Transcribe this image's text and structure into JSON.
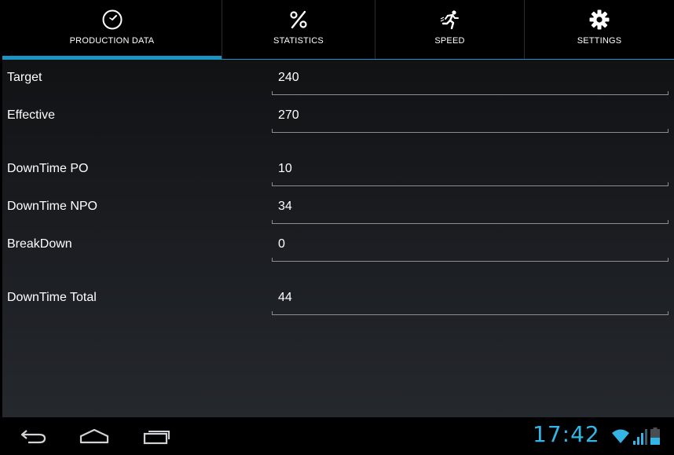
{
  "tabs": [
    {
      "label": "PRODUCTION DATA",
      "icon": "clock-gauge-icon",
      "selected": true
    },
    {
      "label": "STATISTICS",
      "icon": "percent-icon",
      "selected": false
    },
    {
      "label": "SPEED",
      "icon": "running-person-icon",
      "selected": false
    },
    {
      "label": "SETTINGS",
      "icon": "gear-icon",
      "selected": false
    }
  ],
  "form": {
    "target": {
      "label": "Target",
      "value": "240"
    },
    "effective": {
      "label": "Effective",
      "value": "270"
    },
    "downtime_po": {
      "label": "DownTime PO",
      "value": "10"
    },
    "downtime_npo": {
      "label": "DownTime NPO",
      "value": "34"
    },
    "breakdown": {
      "label": "BreakDown",
      "value": "0"
    },
    "downtime_total": {
      "label": "DownTime Total",
      "value": "44"
    }
  },
  "statusbar": {
    "time": "17:42",
    "accent_color": "#33b5e5"
  },
  "colors": {
    "tab_indicator": "#1d93c4",
    "clock": "#33b5e5"
  }
}
